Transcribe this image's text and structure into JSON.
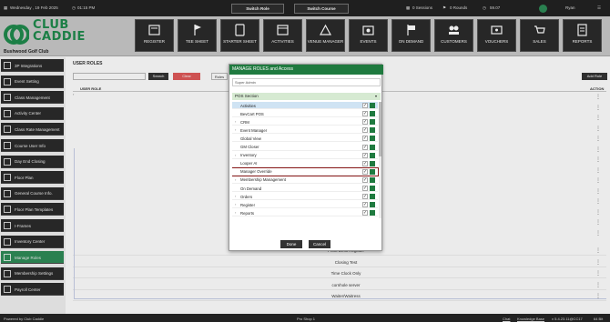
{
  "topbar": {
    "date": "Wednesday , 19 Feb 2025",
    "time": "01:15 PM",
    "switch_role": "Switch Role",
    "switch_course": "Switch Course",
    "sessions": "0 Sessions",
    "rounds": "0 Rounds",
    "balance": "59.07",
    "user": "Ryan"
  },
  "brand": {
    "line1": "CLUB",
    "line2": "CADDIE",
    "club_name": "Bushwood Golf Club",
    "accent": "#1f8a4c"
  },
  "nav": [
    {
      "label": "REGISTER",
      "icon": "register-icon"
    },
    {
      "label": "TEE SHEET",
      "icon": "golf-flag-icon"
    },
    {
      "label": "STARTER SHEET",
      "icon": "tablet-icon"
    },
    {
      "label": "ACTIVITIES",
      "icon": "calendar-icon"
    },
    {
      "label": "VENUE MANAGER",
      "icon": "venue-icon"
    },
    {
      "label": "EVENTS",
      "icon": "events-icon"
    },
    {
      "label": "ON DEMAND",
      "icon": "flag-icon"
    },
    {
      "label": "CUSTOMERS",
      "icon": "customers-icon"
    },
    {
      "label": "VOUCHERS",
      "icon": "vouchers-icon"
    },
    {
      "label": "SALES",
      "icon": "sales-icon"
    },
    {
      "label": "REPORTS",
      "icon": "reports-icon"
    }
  ],
  "sidebar": [
    {
      "label": "3P Integrations"
    },
    {
      "label": "Event Setting"
    },
    {
      "label": "Class Management"
    },
    {
      "label": "Activity Center"
    },
    {
      "label": "Class Rate Management"
    },
    {
      "label": "Course User Info"
    },
    {
      "label": "Day End Closing"
    },
    {
      "label": "Floor Plan"
    },
    {
      "label": "General Course Info."
    },
    {
      "label": "Floor Plan Templates"
    },
    {
      "label": "I-Frames"
    },
    {
      "label": "Inventory Center"
    },
    {
      "label": "Manage Roles"
    },
    {
      "label": "Membership Settings"
    },
    {
      "label": "Payroll Center"
    }
  ],
  "main": {
    "title": "USER ROLES",
    "search_placeholder": "",
    "search_label": "Search",
    "clear_label": "Clear",
    "roles_label": "Roles",
    "add_role_label": "Add Role",
    "col_user_role": "USER ROLE",
    "col_action": "ACTION",
    "rows": [
      "Front Desk Register",
      "Closing Test",
      "Time Clock Only",
      "cornhole server",
      "Waiter/Waitress"
    ]
  },
  "modal": {
    "title": "MANAGE ROLES and Access",
    "role_value": "Super Admin",
    "section": "POS Section",
    "permissions": [
      {
        "name": "Activities",
        "expand": false
      },
      {
        "name": "BevCart POS",
        "expand": false
      },
      {
        "name": "CRM",
        "expand": true
      },
      {
        "name": "Event Manager",
        "expand": true
      },
      {
        "name": "Global View",
        "expand": false
      },
      {
        "name": "GM Closer",
        "expand": false
      },
      {
        "name": "Inventory",
        "expand": true
      },
      {
        "name": "Looper AI",
        "expand": false
      },
      {
        "name": "Manager Override",
        "expand": false
      },
      {
        "name": "Membership Management",
        "expand": true
      },
      {
        "name": "On Demand",
        "expand": false
      },
      {
        "name": "Orders",
        "expand": true
      },
      {
        "name": "Register",
        "expand": true
      },
      {
        "name": "Reports",
        "expand": true
      }
    ],
    "done_label": "Done",
    "cancel_label": "Cancel"
  },
  "footer": {
    "powered": "Powered by Club Caddie",
    "shop": "Pro Shop 1",
    "chat": "Chat",
    "kb": "Knowledge Base",
    "version": "v 5.4.23.11@CC17",
    "size": "64 Bit"
  }
}
